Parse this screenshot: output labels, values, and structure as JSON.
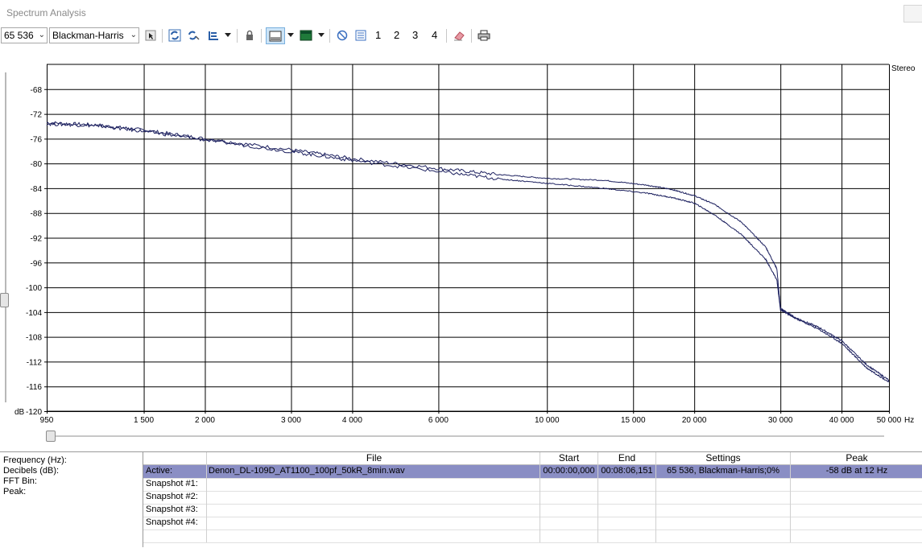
{
  "window": {
    "title": "Spectrum Analysis"
  },
  "toolbar": {
    "fft_size": "65 536",
    "window_function": "Blackman-Harris",
    "snapshot_labels": [
      "1",
      "2",
      "3",
      "4"
    ],
    "icons": [
      "select-cursor-icon",
      "refresh-icon",
      "auto-refresh-icon",
      "scale-icon",
      "lock-icon",
      "graph-view-icon",
      "spectrogram-icon",
      "clear-icon",
      "snapshot-list-icon",
      "erase-icon",
      "print-icon"
    ]
  },
  "chart": {
    "channel_label": "Stereo",
    "y_axis_unit": "dB",
    "x_axis_unit": "Hz",
    "line_color": "#1b1f5e",
    "grid_color": "#000000"
  },
  "chart_data": {
    "type": "line",
    "xlabel": "Hz",
    "ylabel": "dB",
    "x_scale": "log",
    "xlim": [
      950,
      50000
    ],
    "ylim": [
      -120,
      -64
    ],
    "x_ticks": [
      950,
      1500,
      2000,
      3000,
      4000,
      6000,
      10000,
      15000,
      20000,
      30000,
      40000,
      50000
    ],
    "x_tick_labels": [
      "950",
      "1 500",
      "2 000",
      "3 000",
      "4 000",
      "6 000",
      "10 000",
      "15 000",
      "20 000",
      "30 000",
      "40 000",
      "50 000"
    ],
    "y_ticks": [
      -68,
      -72,
      -76,
      -80,
      -84,
      -88,
      -92,
      -96,
      -100,
      -104,
      -108,
      -112,
      -116,
      -120
    ],
    "y_tick_labels": [
      "-68",
      "-72",
      "-76",
      "-80",
      "-84",
      "-88",
      "-92",
      "-96",
      "-100",
      "-104",
      "-108",
      "-112",
      "-116",
      "-120"
    ],
    "grid": true,
    "series": [
      {
        "points": [
          [
            950,
            -73.4
          ],
          [
            1200,
            -73.8
          ],
          [
            1500,
            -74.6
          ],
          [
            2000,
            -76.0
          ],
          [
            3000,
            -77.8
          ],
          [
            4000,
            -79.2
          ],
          [
            6000,
            -80.8
          ],
          [
            8000,
            -81.8
          ],
          [
            10000,
            -82.4
          ],
          [
            13000,
            -82.7
          ],
          [
            16000,
            -83.5
          ],
          [
            18000,
            -84.2
          ],
          [
            20000,
            -85.2
          ],
          [
            22000,
            -86.6
          ],
          [
            25000,
            -89.5
          ],
          [
            28000,
            -93.5
          ],
          [
            29500,
            -97.0
          ],
          [
            30000,
            -103.4
          ],
          [
            32000,
            -104.8
          ],
          [
            36000,
            -106.5
          ],
          [
            40000,
            -108.6
          ],
          [
            45000,
            -112.5
          ],
          [
            50000,
            -115.0
          ]
        ]
      },
      {
        "points": [
          [
            950,
            -73.6
          ],
          [
            1200,
            -73.9
          ],
          [
            1500,
            -74.8
          ],
          [
            2000,
            -76.2
          ],
          [
            3000,
            -78.1
          ],
          [
            4000,
            -79.5
          ],
          [
            6000,
            -81.3
          ],
          [
            8000,
            -82.5
          ],
          [
            10000,
            -83.2
          ],
          [
            13000,
            -84.0
          ],
          [
            16000,
            -84.8
          ],
          [
            18000,
            -85.5
          ],
          [
            20000,
            -86.4
          ],
          [
            22000,
            -88.3
          ],
          [
            25000,
            -91.5
          ],
          [
            28000,
            -95.5
          ],
          [
            29500,
            -98.8
          ],
          [
            30000,
            -103.6
          ],
          [
            32000,
            -104.9
          ],
          [
            36000,
            -106.8
          ],
          [
            40000,
            -109.0
          ],
          [
            45000,
            -113.0
          ],
          [
            50000,
            -115.3
          ]
        ]
      }
    ]
  },
  "info_panel": {
    "labels": [
      "Frequency (Hz):",
      "Decibels (dB):",
      "FFT Bin:",
      "Peak:"
    ],
    "headers": [
      "",
      "File",
      "Start",
      "End",
      "Settings",
      "Peak"
    ],
    "rows": [
      {
        "label": "Active:",
        "file": "Denon_DL-109D_AT1100_100pf_50kR_8min.wav",
        "start": "00:00:00,000",
        "end": "00:08:06,151",
        "settings": "65 536, Blackman-Harris;0%",
        "peak": "-58 dB at 12 Hz"
      },
      {
        "label": "Snapshot #1:",
        "file": "",
        "start": "",
        "end": "",
        "settings": "",
        "peak": ""
      },
      {
        "label": "Snapshot #2:",
        "file": "",
        "start": "",
        "end": "",
        "settings": "",
        "peak": ""
      },
      {
        "label": "Snapshot #3:",
        "file": "",
        "start": "",
        "end": "",
        "settings": "",
        "peak": ""
      },
      {
        "label": "Snapshot #4:",
        "file": "",
        "start": "",
        "end": "",
        "settings": "",
        "peak": ""
      }
    ]
  }
}
